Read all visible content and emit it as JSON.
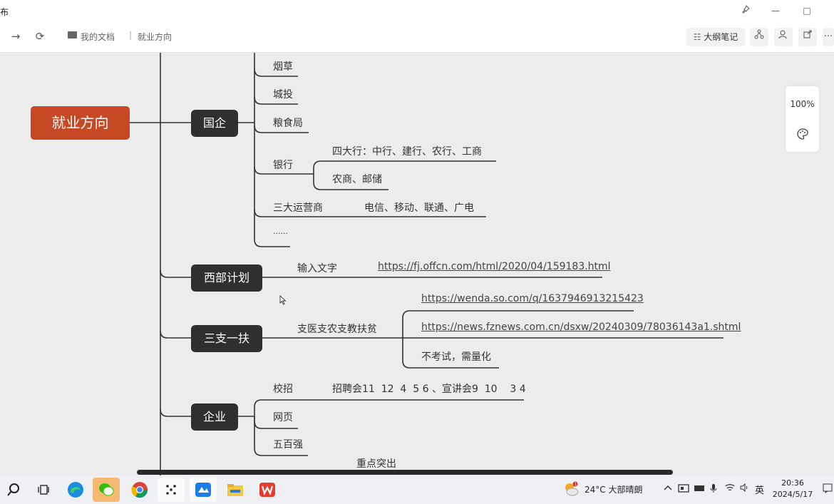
{
  "window": {
    "title": "布",
    "pin_icon": "pin-icon",
    "minimize": "—",
    "maximize": "□"
  },
  "nav": {
    "forward_icon": "→",
    "refresh_icon": "⟳",
    "breadcrumb": {
      "folder": "我的文档",
      "separator": "|",
      "current": "就业方向"
    },
    "outline_button": "大纲笔记",
    "more_icon": "···"
  },
  "mindmap": {
    "root": "就业方向",
    "branches": [
      {
        "label": "国企",
        "children": [
          "烟草",
          "城投",
          "粮食局",
          "银行",
          "三大运营商",
          "......"
        ],
        "bank_children": [
          "四大行：中行、建行、农行、工商",
          "农商、邮储"
        ],
        "operators": "电信、移动、联通、广电"
      },
      {
        "label": "西部计划",
        "children": [
          "输入文字"
        ],
        "link": "https://fj.offcn.com/html/2020/04/159183.html"
      },
      {
        "label": "三支一扶",
        "children": [
          "支医支农支教扶贫"
        ],
        "sub": [
          "https://wenda.so.com/q/1637946913215423",
          "https://news.fznews.com.cn/dsxw/20240309/78036143a1.shtml",
          "不考试，需量化"
        ]
      },
      {
        "label": "企业",
        "children": [
          "校招",
          "网页",
          "五百强"
        ],
        "campus": "招聘会11  12  4  5 6 、宣讲会9  10    3 4"
      }
    ],
    "floating": "重点突出"
  },
  "zoom": {
    "value": "100%"
  },
  "taskbar": {
    "weather": "24°C  大部晴朗",
    "lang": "英",
    "time": "20:36",
    "date": "2024/5/17"
  },
  "colors": {
    "root": "#c74824",
    "node": "#2f2f2f",
    "line": "#333333"
  }
}
